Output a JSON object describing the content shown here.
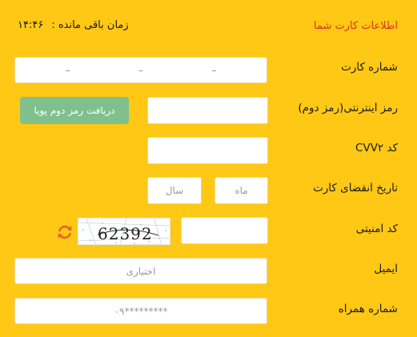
{
  "header": {
    "title": "اطلاعات کارت شما",
    "timer_label": "زمان باقی مانده :",
    "timer_value": "۱۴:۴۶"
  },
  "fields": {
    "card_number": {
      "label": "شماره کارت",
      "separator": "–"
    },
    "pin2": {
      "label": "رمز اینترنتی(رمز دوم)",
      "otp_button": "دریافت رمز دوم پویا"
    },
    "cvv2": {
      "label": "کد CVV۲"
    },
    "expiry": {
      "label": "تاریخ انقضای کارت",
      "month_placeholder": "ماه",
      "year_placeholder": "سال"
    },
    "captcha": {
      "label": "کد امنیتی",
      "code": "62392"
    },
    "email": {
      "label": "ایمیل",
      "placeholder": "اختیاری"
    },
    "mobile": {
      "label": "شماره همراه",
      "placeholder": "۰۹*********"
    }
  },
  "colors": {
    "background": "#ffc814",
    "title": "#d8341a",
    "otp_button": "#7fc08d",
    "refresh_icon": "#e9622a"
  },
  "icons": {
    "refresh": "refresh-icon"
  }
}
